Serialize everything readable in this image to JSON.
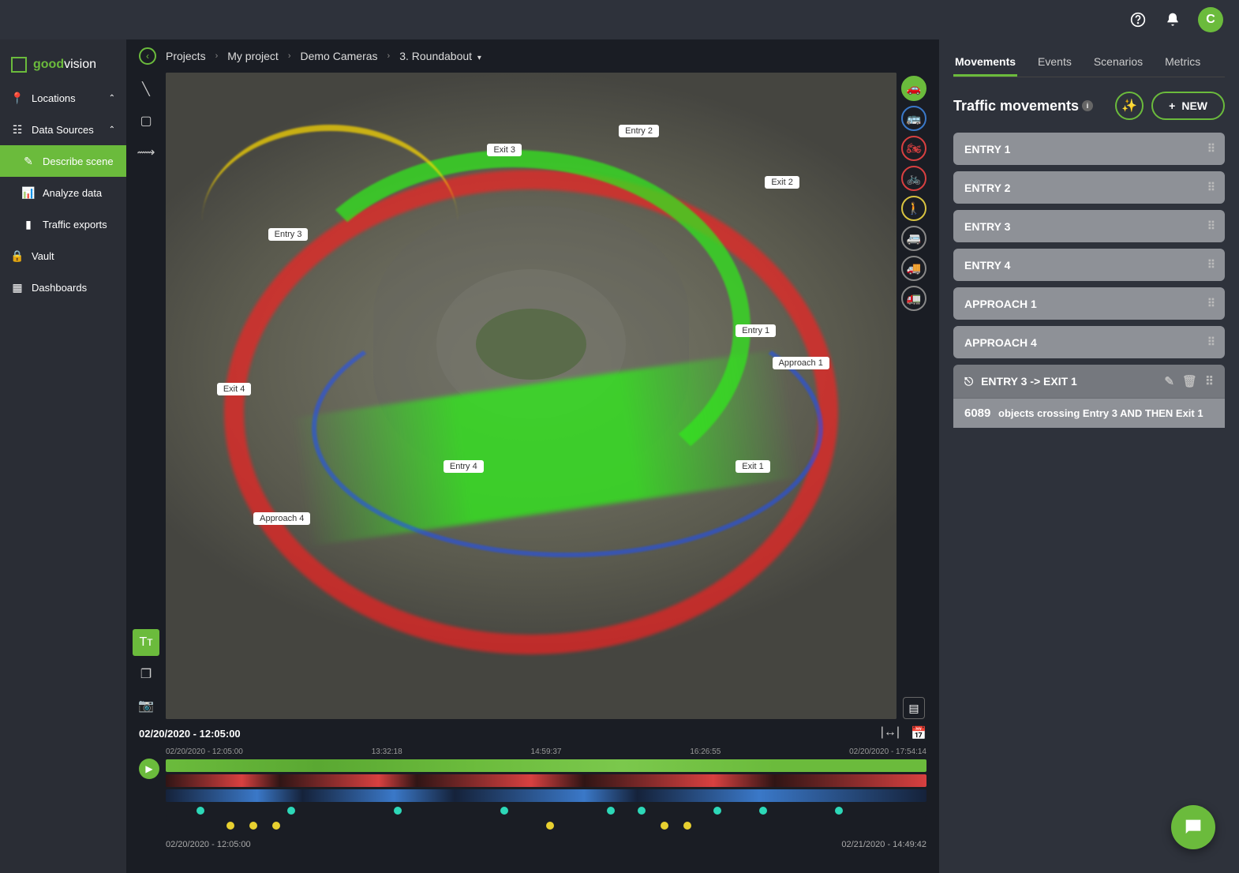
{
  "header": {
    "avatar_letter": "C"
  },
  "logo": {
    "good": "good",
    "vision": "vision"
  },
  "sidebar": {
    "locations": "Locations",
    "data_sources": "Data Sources",
    "describe": "Describe scene",
    "analyze": "Analyze data",
    "exports": "Traffic exports",
    "vault": "Vault",
    "dashboards": "Dashboards"
  },
  "breadcrumb": {
    "projects": "Projects",
    "my_project": "My project",
    "demo": "Demo Cameras",
    "roundabout": "3. Roundabout"
  },
  "scene_labels": {
    "entry1": "Entry 1",
    "entry2": "Entry 2",
    "entry3": "Entry 3",
    "entry4": "Entry 4",
    "exit1": "Exit 1",
    "exit2": "Exit 2",
    "exit3": "Exit 3",
    "exit4": "Exit 4",
    "approach1": "Approach 1",
    "approach4": "Approach 4"
  },
  "timeline": {
    "current": "02/20/2020 - 12:05:00",
    "ticks": [
      "02/20/2020 - 12:05:00",
      "13:32:18",
      "14:59:37",
      "16:26:55",
      "02/20/2020 - 17:54:14"
    ],
    "foot_start": "02/20/2020 - 12:05:00",
    "foot_end": "02/21/2020 - 14:49:42"
  },
  "panel": {
    "tabs": {
      "movements": "Movements",
      "events": "Events",
      "scenarios": "Scenarios",
      "metrics": "Metrics"
    },
    "title": "Traffic movements",
    "new_btn": "NEW",
    "items": [
      "ENTRY 1",
      "ENTRY 2",
      "ENTRY 3",
      "ENTRY 4",
      "APPROACH 1",
      "APPROACH 4"
    ],
    "selected": {
      "title": "ENTRY 3 -> EXIT 1",
      "count": "6089",
      "desc": "objects crossing Entry 3 AND THEN Exit 1"
    }
  }
}
